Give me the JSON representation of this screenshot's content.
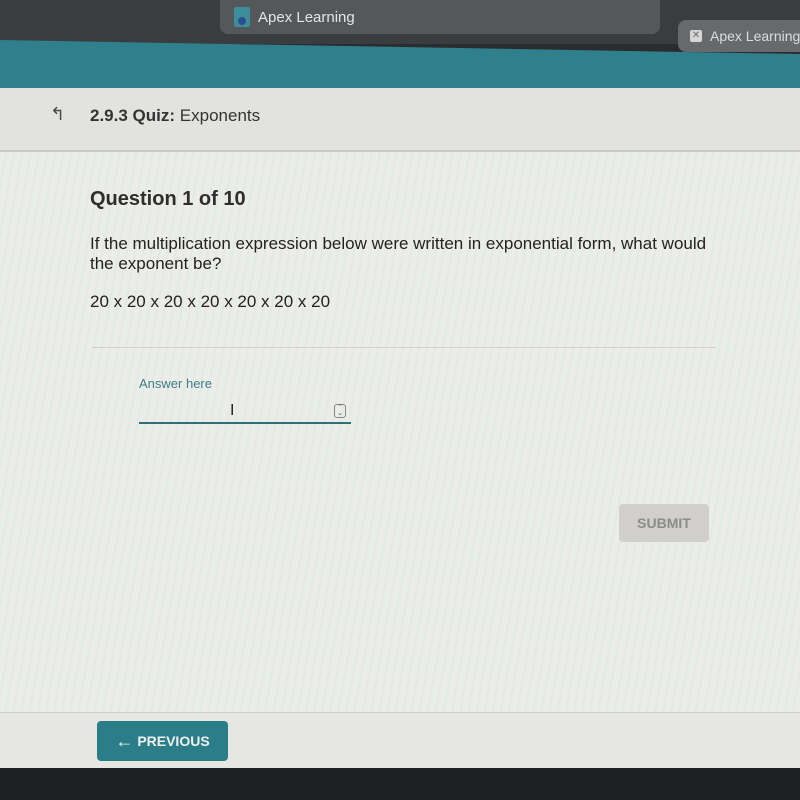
{
  "browser": {
    "tabs": [
      {
        "label": "Apex Learning",
        "active": true,
        "icon": "apex-logo-icon"
      },
      {
        "label": "Apex Learning",
        "active": false,
        "icon": "close-icon"
      }
    ]
  },
  "header": {
    "back_icon": "↰",
    "section": "2.9.3",
    "type": "Quiz:",
    "title": "Exponents"
  },
  "question": {
    "number_label": "Question 1 of 10",
    "text": "If the multiplication expression below were written in exponential form, what would the exponent be?",
    "expression": "20 x 20 x 20 x 20 x 20 x 20 x 20"
  },
  "answer": {
    "label": "Answer here",
    "value": "",
    "spinner_glyph": "⌃⌄"
  },
  "buttons": {
    "submit": "SUBMIT",
    "previous": "PREVIOUS",
    "previous_icon": "←"
  }
}
